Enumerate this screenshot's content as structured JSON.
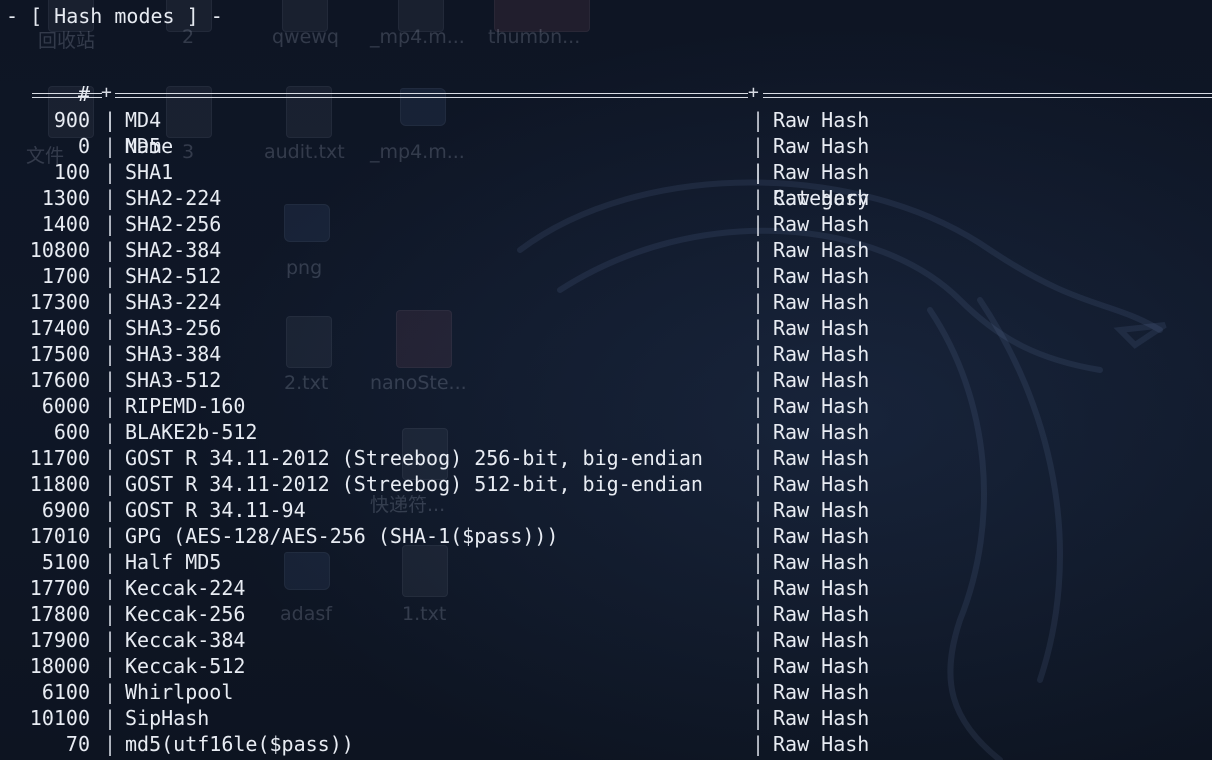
{
  "terminal": {
    "title": "- [ Hash modes ] -",
    "headers": {
      "num": "#",
      "name": "Name",
      "category": "Category"
    },
    "separator": "|",
    "rule_plus": "+",
    "rows": [
      {
        "num": "900",
        "name": "MD4",
        "category": "Raw Hash"
      },
      {
        "num": "0",
        "name": "MD5",
        "category": "Raw Hash"
      },
      {
        "num": "100",
        "name": "SHA1",
        "category": "Raw Hash"
      },
      {
        "num": "1300",
        "name": "SHA2-224",
        "category": "Raw Hash"
      },
      {
        "num": "1400",
        "name": "SHA2-256",
        "category": "Raw Hash"
      },
      {
        "num": "10800",
        "name": "SHA2-384",
        "category": "Raw Hash"
      },
      {
        "num": "1700",
        "name": "SHA2-512",
        "category": "Raw Hash"
      },
      {
        "num": "17300",
        "name": "SHA3-224",
        "category": "Raw Hash"
      },
      {
        "num": "17400",
        "name": "SHA3-256",
        "category": "Raw Hash"
      },
      {
        "num": "17500",
        "name": "SHA3-384",
        "category": "Raw Hash"
      },
      {
        "num": "17600",
        "name": "SHA3-512",
        "category": "Raw Hash"
      },
      {
        "num": "6000",
        "name": "RIPEMD-160",
        "category": "Raw Hash"
      },
      {
        "num": "600",
        "name": "BLAKE2b-512",
        "category": "Raw Hash"
      },
      {
        "num": "11700",
        "name": "GOST R 34.11-2012 (Streebog) 256-bit, big-endian",
        "category": "Raw Hash"
      },
      {
        "num": "11800",
        "name": "GOST R 34.11-2012 (Streebog) 512-bit, big-endian",
        "category": "Raw Hash"
      },
      {
        "num": "6900",
        "name": "GOST R 34.11-94",
        "category": "Raw Hash"
      },
      {
        "num": "17010",
        "name": "GPG (AES-128/AES-256 (SHA-1($pass)))",
        "category": "Raw Hash"
      },
      {
        "num": "5100",
        "name": "Half MD5",
        "category": "Raw Hash"
      },
      {
        "num": "17700",
        "name": "Keccak-224",
        "category": "Raw Hash"
      },
      {
        "num": "17800",
        "name": "Keccak-256",
        "category": "Raw Hash"
      },
      {
        "num": "17900",
        "name": "Keccak-384",
        "category": "Raw Hash"
      },
      {
        "num": "18000",
        "name": "Keccak-512",
        "category": "Raw Hash"
      },
      {
        "num": "6100",
        "name": "Whirlpool",
        "category": "Raw Hash"
      },
      {
        "num": "10100",
        "name": "SipHash",
        "category": "Raw Hash"
      },
      {
        "num": "70",
        "name": "md5(utf16le($pass))",
        "category": "Raw Hash"
      }
    ]
  },
  "desktop": {
    "icons": [
      {
        "label": "回收站",
        "type": "file"
      },
      {
        "label": "2",
        "type": "file"
      },
      {
        "label": "qwewq",
        "type": "file"
      },
      {
        "label": "_mp4.m...",
        "type": "file"
      },
      {
        "label": "thumbn...",
        "type": "image"
      },
      {
        "label": "文件",
        "type": "file"
      },
      {
        "label": "3",
        "type": "file"
      },
      {
        "label": "audit.txt",
        "type": "file"
      },
      {
        "label": "_mp4.m...",
        "type": "folder"
      },
      {
        "label": "png",
        "type": "folder"
      },
      {
        "label": "2.txt",
        "type": "file"
      },
      {
        "label": "nanoSte...",
        "type": "image"
      },
      {
        "label": "快递符...",
        "type": "file"
      },
      {
        "label": "adasf",
        "type": "folder"
      },
      {
        "label": "1.txt",
        "type": "file"
      }
    ]
  },
  "colors": {
    "background": "#0f1625",
    "text": "#e8ecf3"
  }
}
